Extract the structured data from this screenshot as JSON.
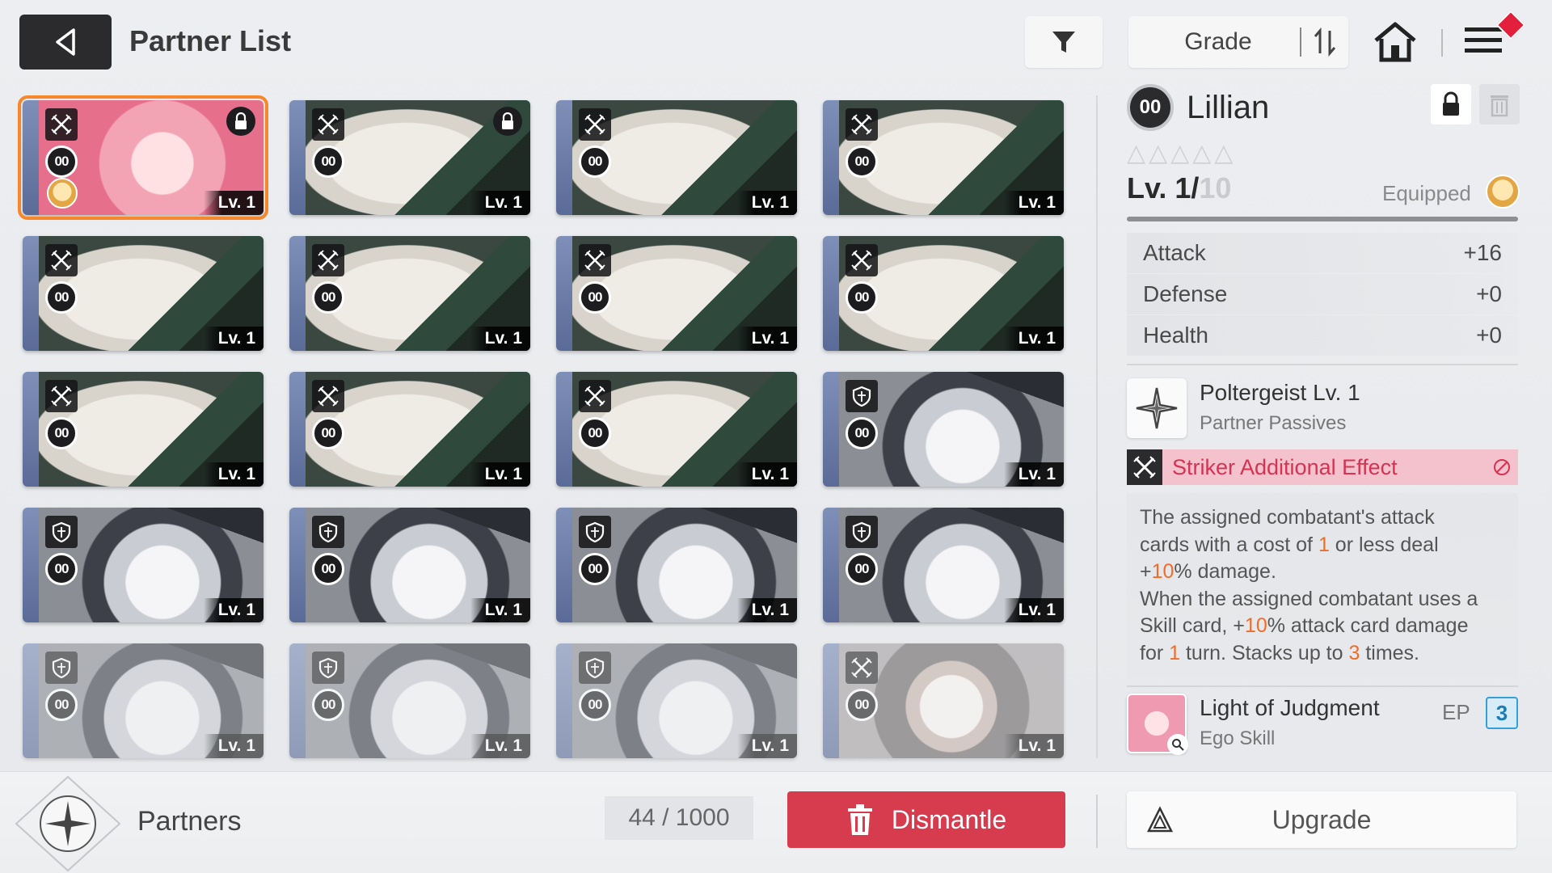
{
  "header": {
    "title": "Partner List",
    "sort_label": "Grade"
  },
  "cards": [
    {
      "art": "pink",
      "cls": "striker",
      "rank": "00",
      "level": "Lv. 1",
      "locked": true,
      "equipped": true,
      "selected": true,
      "dim": false
    },
    {
      "art": "fat",
      "cls": "striker",
      "rank": "00",
      "level": "Lv. 1",
      "locked": true,
      "equipped": false,
      "selected": false,
      "dim": false
    },
    {
      "art": "fat",
      "cls": "striker",
      "rank": "00",
      "level": "Lv. 1",
      "locked": false,
      "equipped": false,
      "selected": false,
      "dim": false
    },
    {
      "art": "fat",
      "cls": "striker",
      "rank": "00",
      "level": "Lv. 1",
      "locked": false,
      "equipped": false,
      "selected": false,
      "dim": false
    },
    {
      "art": "fat",
      "cls": "striker",
      "rank": "00",
      "level": "Lv. 1",
      "locked": false,
      "equipped": false,
      "selected": false,
      "dim": false
    },
    {
      "art": "fat",
      "cls": "striker",
      "rank": "00",
      "level": "Lv. 1",
      "locked": false,
      "equipped": false,
      "selected": false,
      "dim": false
    },
    {
      "art": "fat",
      "cls": "striker",
      "rank": "00",
      "level": "Lv. 1",
      "locked": false,
      "equipped": false,
      "selected": false,
      "dim": false
    },
    {
      "art": "fat",
      "cls": "striker",
      "rank": "00",
      "level": "Lv. 1",
      "locked": false,
      "equipped": false,
      "selected": false,
      "dim": false
    },
    {
      "art": "fat",
      "cls": "striker",
      "rank": "00",
      "level": "Lv. 1",
      "locked": false,
      "equipped": false,
      "selected": false,
      "dim": false
    },
    {
      "art": "fat",
      "cls": "striker",
      "rank": "00",
      "level": "Lv. 1",
      "locked": false,
      "equipped": false,
      "selected": false,
      "dim": false
    },
    {
      "art": "fat",
      "cls": "striker",
      "rank": "00",
      "level": "Lv. 1",
      "locked": false,
      "equipped": false,
      "selected": false,
      "dim": false
    },
    {
      "art": "white",
      "cls": "defender",
      "rank": "00",
      "level": "Lv. 1",
      "locked": false,
      "equipped": false,
      "selected": false,
      "dim": false
    },
    {
      "art": "white",
      "cls": "defender",
      "rank": "00",
      "level": "Lv. 1",
      "locked": false,
      "equipped": false,
      "selected": false,
      "dim": false
    },
    {
      "art": "white",
      "cls": "defender",
      "rank": "00",
      "level": "Lv. 1",
      "locked": false,
      "equipped": false,
      "selected": false,
      "dim": false
    },
    {
      "art": "white",
      "cls": "defender",
      "rank": "00",
      "level": "Lv. 1",
      "locked": false,
      "equipped": false,
      "selected": false,
      "dim": false
    },
    {
      "art": "white",
      "cls": "defender",
      "rank": "00",
      "level": "Lv. 1",
      "locked": false,
      "equipped": false,
      "selected": false,
      "dim": false
    },
    {
      "art": "white",
      "cls": "defender",
      "rank": "00",
      "level": "Lv. 1",
      "locked": false,
      "equipped": false,
      "selected": false,
      "dim": true
    },
    {
      "art": "white",
      "cls": "defender",
      "rank": "00",
      "level": "Lv. 1",
      "locked": false,
      "equipped": false,
      "selected": false,
      "dim": true
    },
    {
      "art": "white",
      "cls": "defender",
      "rank": "00",
      "level": "Lv. 1",
      "locked": false,
      "equipped": false,
      "selected": false,
      "dim": true
    },
    {
      "art": "bunny",
      "cls": "striker",
      "rank": "00",
      "level": "Lv. 1",
      "locked": false,
      "equipped": false,
      "selected": false,
      "dim": true
    }
  ],
  "detail": {
    "rank": "00",
    "name": "Lillian",
    "stars": "△△△△△",
    "level_current": "Lv. 1/",
    "level_max": "10",
    "level_progress": 1.0,
    "equipped_label": "Equipped",
    "stats": [
      {
        "label": "Attack",
        "value": "+16"
      },
      {
        "label": "Defense",
        "value": "+0"
      },
      {
        "label": "Health",
        "value": "+0"
      }
    ],
    "passive": {
      "title": "Poltergeist Lv. 1",
      "subtitle": "Partner Passives"
    },
    "effect": {
      "title": "Striker Additional Effect",
      "desc_parts": [
        [
          "The assigned combatant's attack"
        ],
        [
          "cards with a cost of ",
          "1",
          " or less deal"
        ],
        [
          "+",
          "10",
          "% damage."
        ],
        [
          "When the assigned combatant uses a"
        ],
        [
          "Skill card, +",
          "10",
          "% attack card damage"
        ],
        [
          "for ",
          "1",
          " turn. Stacks up to ",
          "3",
          " times."
        ]
      ]
    },
    "ego": {
      "title": "Light of Judgment",
      "subtitle": "Ego Skill",
      "ep_label": "EP",
      "ep_value": "3"
    }
  },
  "footer": {
    "partners_label": "Partners",
    "count": "44 / 1000",
    "dismantle_label": "Dismantle",
    "upgrade_label": "Upgrade"
  },
  "colors": {
    "accent_orange": "#f6872b",
    "dismantle_red": "#d63b4e",
    "effect_pink": "#f4c2cc",
    "highlight": "#f26b27",
    "ep_blue": "#35a0d8"
  }
}
